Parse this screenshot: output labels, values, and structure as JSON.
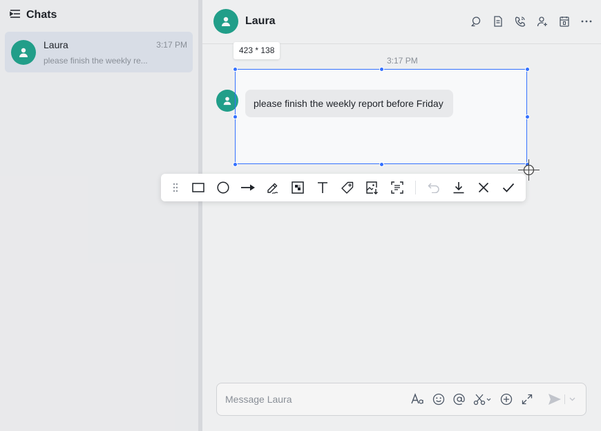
{
  "sidebar": {
    "title": "Chats",
    "chats": [
      {
        "name": "Laura",
        "time": "3:17 PM",
        "preview": "please finish the weekly re..."
      }
    ]
  },
  "header": {
    "contact_name": "Laura",
    "actions": [
      "search-chat-icon",
      "docs-icon",
      "call-icon",
      "add-member-icon",
      "calendar-icon",
      "more-icon"
    ]
  },
  "conversation": {
    "timestamp": "3:17 PM",
    "messages": [
      {
        "sender": "Laura",
        "text": "please finish the weekly report before Friday"
      }
    ]
  },
  "composer": {
    "placeholder": "Message Laura",
    "tools": [
      "text-format-icon",
      "emoji-icon",
      "mention-icon",
      "screenshot-icon",
      "add-icon",
      "expand-icon"
    ],
    "send": "send-icon"
  },
  "screenshot_tool": {
    "size_label": "423 * 138",
    "toolbar": [
      "drag-handle-icon",
      "rectangle-icon",
      "ellipse-icon",
      "arrow-icon",
      "pen-icon",
      "mosaic-icon",
      "text-icon",
      "tag-icon",
      "pin-image-icon",
      "ocr-icon",
      "undo-icon",
      "download-icon",
      "close-icon",
      "confirm-icon"
    ]
  },
  "colors": {
    "avatar": "#23a58f",
    "accent": "#3370ff",
    "selected_chat": "#e1e6f0"
  }
}
